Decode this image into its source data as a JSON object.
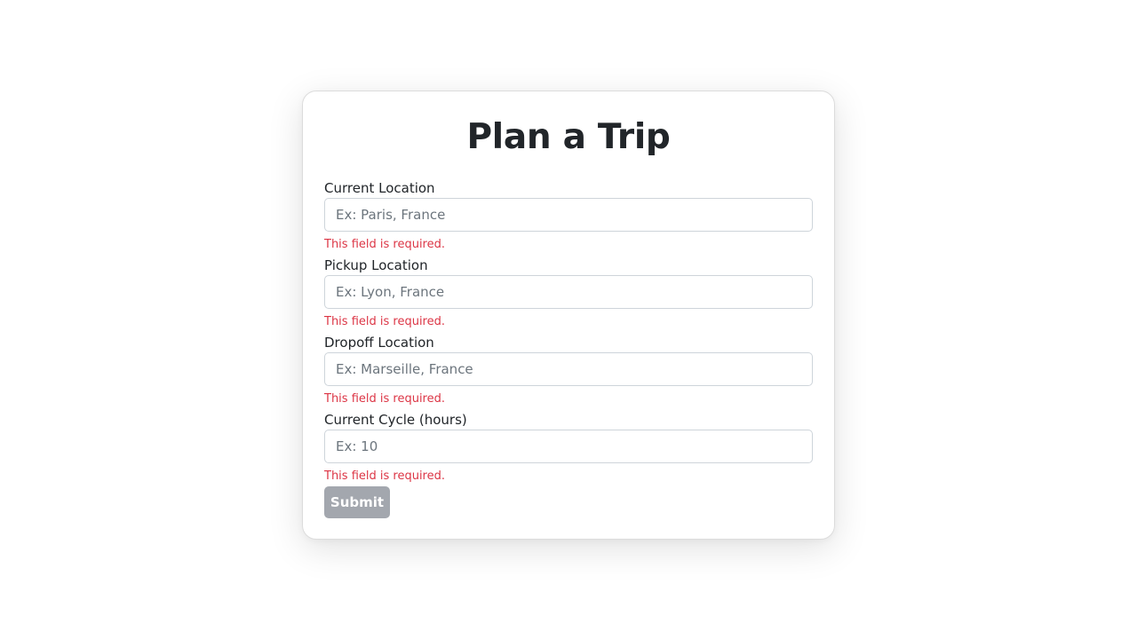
{
  "form": {
    "title": "Plan a Trip",
    "fields": [
      {
        "label": "Current Location",
        "placeholder": "Ex: Paris, France",
        "value": "",
        "error": "This field is required."
      },
      {
        "label": "Pickup Location",
        "placeholder": "Ex: Lyon, France",
        "value": "",
        "error": "This field is required."
      },
      {
        "label": "Dropoff Location",
        "placeholder": "Ex: Marseille, France",
        "value": "",
        "error": "This field is required."
      },
      {
        "label": "Current Cycle (hours)",
        "placeholder": "Ex: 10",
        "value": "",
        "error": "This field is required."
      }
    ],
    "submit_label": "Submit"
  },
  "colors": {
    "error": "#dc3545",
    "submit_disabled": "#a3a7ae",
    "title": "#212529"
  }
}
